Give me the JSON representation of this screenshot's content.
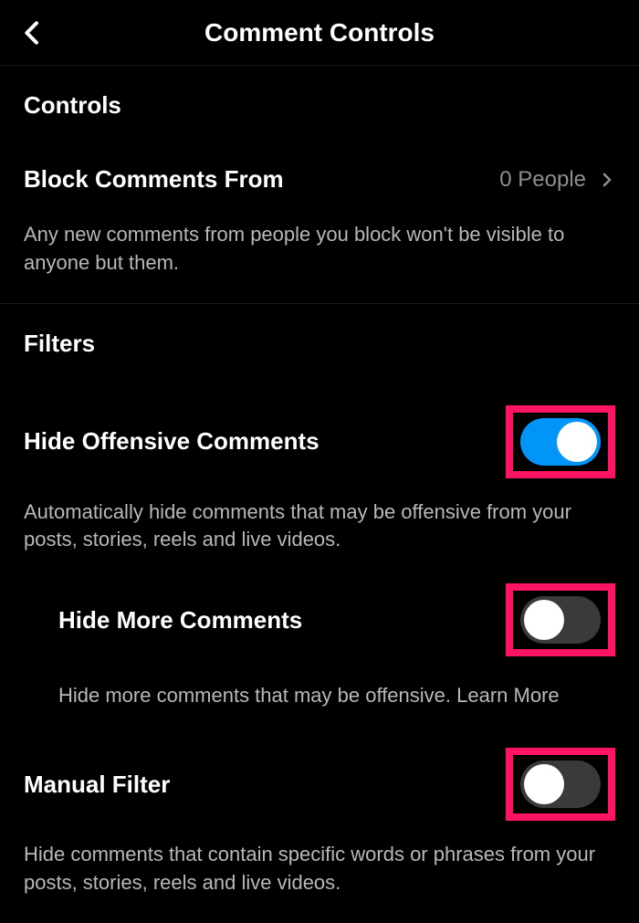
{
  "header": {
    "title": "Comment Controls"
  },
  "controls": {
    "sectionTitle": "Controls",
    "blockComments": {
      "label": "Block Comments From",
      "value": "0 People",
      "description": "Any new comments from people you block won't be visible to anyone but them."
    }
  },
  "filters": {
    "sectionTitle": "Filters",
    "hideOffensive": {
      "label": "Hide Offensive Comments",
      "description": "Automatically hide comments that may be offensive from your posts, stories, reels and live videos.",
      "enabled": true
    },
    "hideMore": {
      "label": "Hide More Comments",
      "description": "Hide more comments that may be offensive. ",
      "learnMoreLabel": "Learn More",
      "enabled": false
    },
    "manualFilter": {
      "label": "Manual Filter",
      "description": "Hide comments that contain specific words or phrases from your posts, stories, reels and live videos.",
      "enabled": false
    }
  },
  "highlightColor": "#ff1464",
  "toggleOnColor": "#0095f6"
}
